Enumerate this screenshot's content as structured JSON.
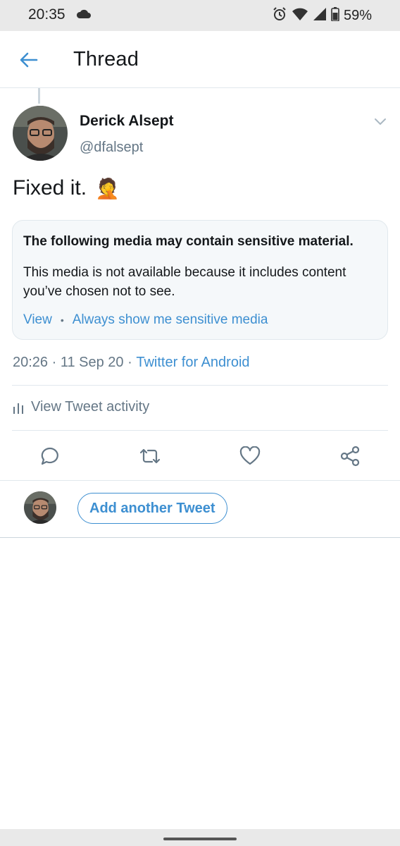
{
  "status_bar": {
    "time": "20:35",
    "battery": "59%",
    "icons": [
      "cloud-icon",
      "alarm-icon",
      "wifi-icon",
      "signal-icon",
      "battery-icon"
    ]
  },
  "header": {
    "title": "Thread",
    "back_icon": "back-arrow-icon"
  },
  "tweet": {
    "author_name": "Derick Alsept",
    "author_handle": "@dfalsept",
    "text": "Fixed it.",
    "emoji": "🤦",
    "sensitive": {
      "title": "The following media may contain sensitive material.",
      "body": "This media is not available because it includes content you’ve chosen not to see.",
      "view_label": "View",
      "always_show_label": "Always show me sensitive media"
    },
    "time": "20:26",
    "date": "11 Sep 20",
    "source": "Twitter for Android",
    "activity_label": "View Tweet activity"
  },
  "actions": {
    "reply": "reply-icon",
    "retweet": "retweet-icon",
    "like": "heart-icon",
    "share": "share-icon"
  },
  "reply_bar": {
    "button_label": "Add another Tweet"
  },
  "colors": {
    "accent": "#3d8fd1",
    "text": "#14171a",
    "secondary": "#657786",
    "card_bg": "#f5f8fa",
    "divider": "#e1e8ed"
  }
}
